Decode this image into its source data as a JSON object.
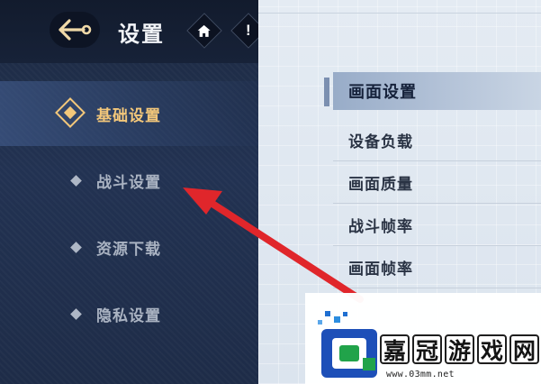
{
  "header": {
    "title": "设置",
    "back_icon": "anchor-back-arrow-icon",
    "home_icon": "home-icon",
    "alert_icon": "exclamation-icon",
    "alert_glyph": "!"
  },
  "sidebar": {
    "items": [
      {
        "label": "基础设置",
        "active": true
      },
      {
        "label": "战斗设置",
        "active": false
      },
      {
        "label": "资源下载",
        "active": false
      },
      {
        "label": "隐私设置",
        "active": false
      }
    ]
  },
  "content": {
    "rows": [
      {
        "label": "画面设置",
        "active": true
      },
      {
        "label": "设备负载",
        "active": false
      },
      {
        "label": "画面质量",
        "active": false
      },
      {
        "label": "战斗帧率",
        "active": false
      },
      {
        "label": "画面帧率",
        "active": false
      }
    ]
  },
  "watermark": {
    "brand_chars": [
      "嘉",
      "冠",
      "游",
      "戏",
      "网"
    ],
    "url": "www.03mm.net"
  },
  "colors": {
    "sidebar_bg": "#223252",
    "active_gold": "#f3c77a",
    "arrow_red": "#e0262b",
    "content_bg": "#dfe7f0"
  }
}
